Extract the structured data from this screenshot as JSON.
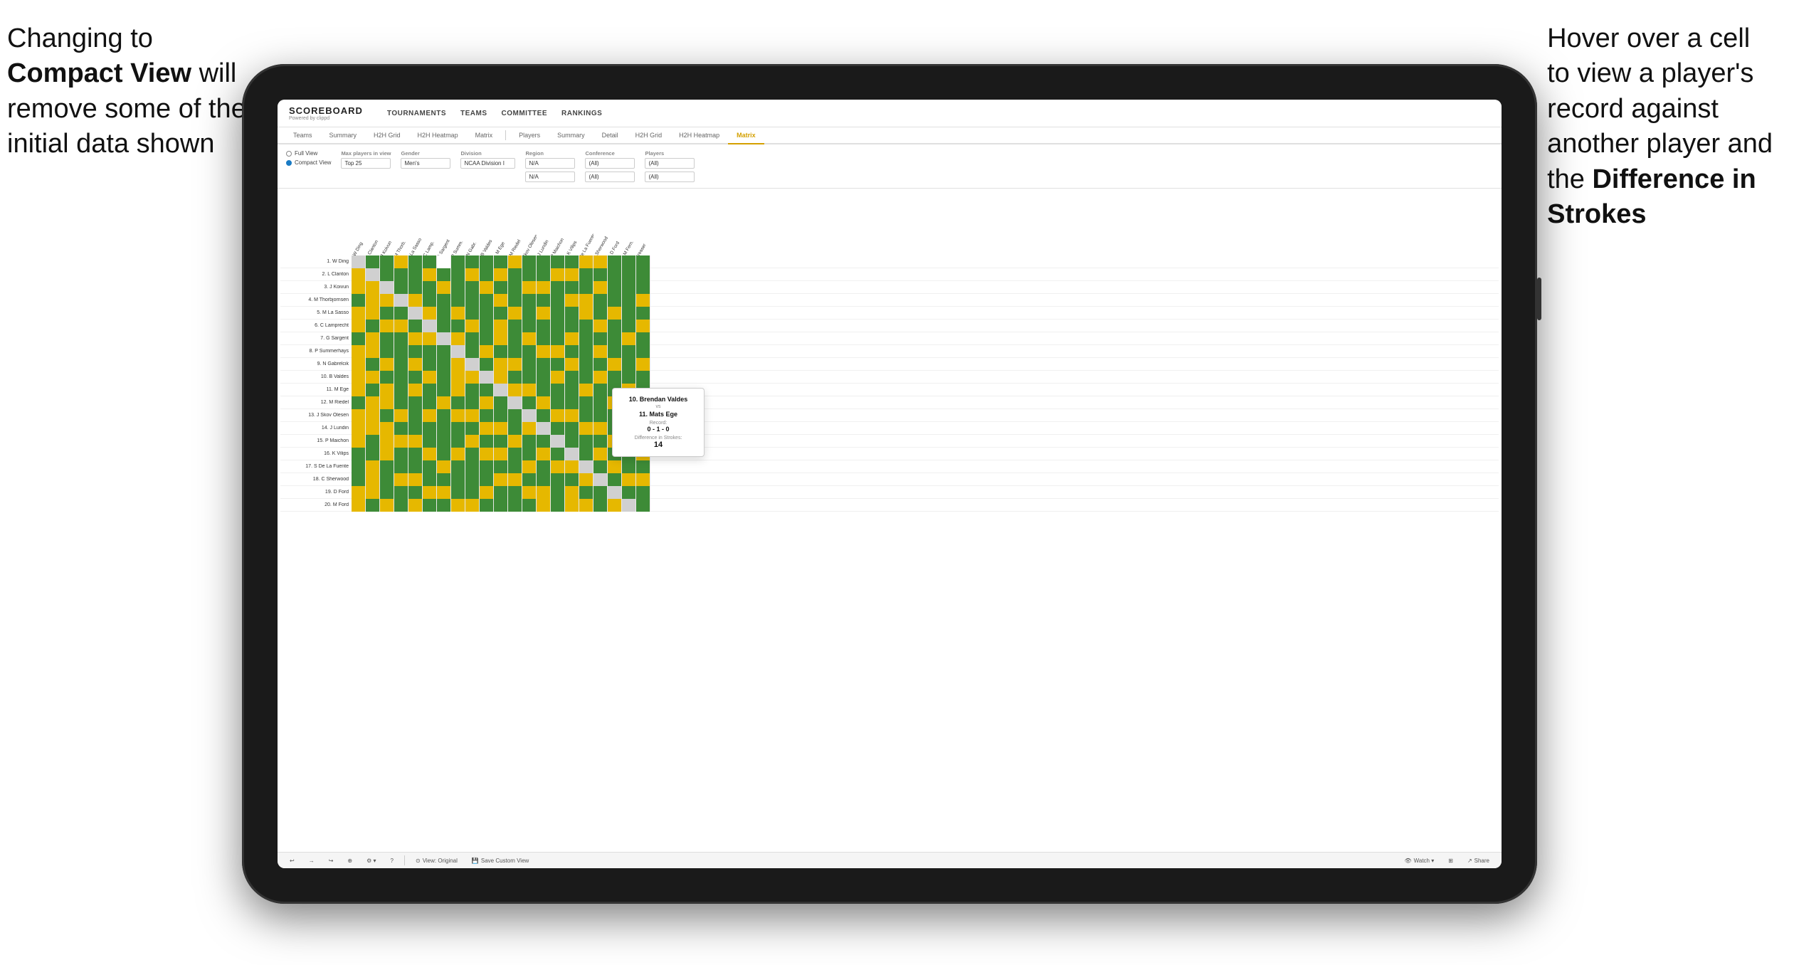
{
  "annotations": {
    "left": {
      "line1": "Changing to",
      "line2_bold": "Compact View",
      "line2_rest": " will",
      "line3": "remove some of the",
      "line4": "initial data shown"
    },
    "right": {
      "line1": "Hover over a cell",
      "line2": "to view a player's",
      "line3": "record against",
      "line4": "another player and",
      "line5_pre": "the ",
      "line5_bold": "Difference in",
      "line6_bold": "Strokes"
    }
  },
  "nav": {
    "logo": "SCOREBOARD",
    "logo_sub": "Powered by clippd",
    "links": [
      "TOURNAMENTS",
      "TEAMS",
      "COMMITTEE",
      "RANKINGS"
    ]
  },
  "tabs": {
    "group1": [
      "Teams",
      "Summary",
      "H2H Grid",
      "H2H Heatmap",
      "Matrix"
    ],
    "group2": [
      "Players",
      "Summary",
      "Detail",
      "H2H Grid",
      "H2H Heatmap",
      "Matrix"
    ],
    "active": "Matrix"
  },
  "filters": {
    "view_label": "",
    "full_view": "Full View",
    "compact_view": "Compact View",
    "max_players_label": "Max players in view",
    "max_players_value": "Top 25",
    "gender_label": "Gender",
    "gender_value": "Men's",
    "division_label": "Division",
    "division_value": "NCAA Division I",
    "region_label": "Region",
    "region_value1": "N/A",
    "region_value2": "N/A",
    "conference_label": "Conference",
    "conference_value1": "(All)",
    "conference_value2": "(All)",
    "players_label": "Players",
    "players_value1": "(All)",
    "players_value2": "(All)"
  },
  "players": [
    "1. W Ding",
    "2. L Clanton",
    "3. J Koivun",
    "4. M Thorbjornsen",
    "5. M La Sasso",
    "6. C Lamprecht",
    "7. G Sargent",
    "8. P Summerhays",
    "9. N Gabrelcik",
    "10. B Valdes",
    "11. M Ege",
    "12. M Riedel",
    "13. J Skov Olesen",
    "14. J Lundin",
    "15. P Maichon",
    "16. K Vilips",
    "17. S De La Fuente",
    "18. C Sherwood",
    "19. D Ford",
    "20. M Ford"
  ],
  "col_headers": [
    "1. W Ding",
    "2. L Clanton",
    "3. J Koivun",
    "4. M Thorb.",
    "5. M La Sasso",
    "6. C Lamp.",
    "7. G Sargent",
    "8. P Summ.",
    "9. N Gabr.",
    "10. B Valdes",
    "11. M Ege",
    "12. M Riedel",
    "13. J Skov Olesen",
    "14. J Lundin",
    "15. P Maichon",
    "16. K Vilips",
    "17. S De La Fuente",
    "18. C Sherwood",
    "19. D Ford",
    "20. M Fern.",
    "Greaser"
  ],
  "tooltip": {
    "player1": "10. Brendan Valdes",
    "vs_label": "vs",
    "player2": "11. Mats Ege",
    "record_label": "Record:",
    "record": "0 - 1 - 0",
    "diff_label": "Difference in Strokes:",
    "diff_value": "14"
  },
  "toolbar": {
    "undo": "↩",
    "redo": "↪",
    "view_original": "View: Original",
    "save_custom": "Save Custom View",
    "watch": "Watch ▾",
    "share": "Share"
  }
}
